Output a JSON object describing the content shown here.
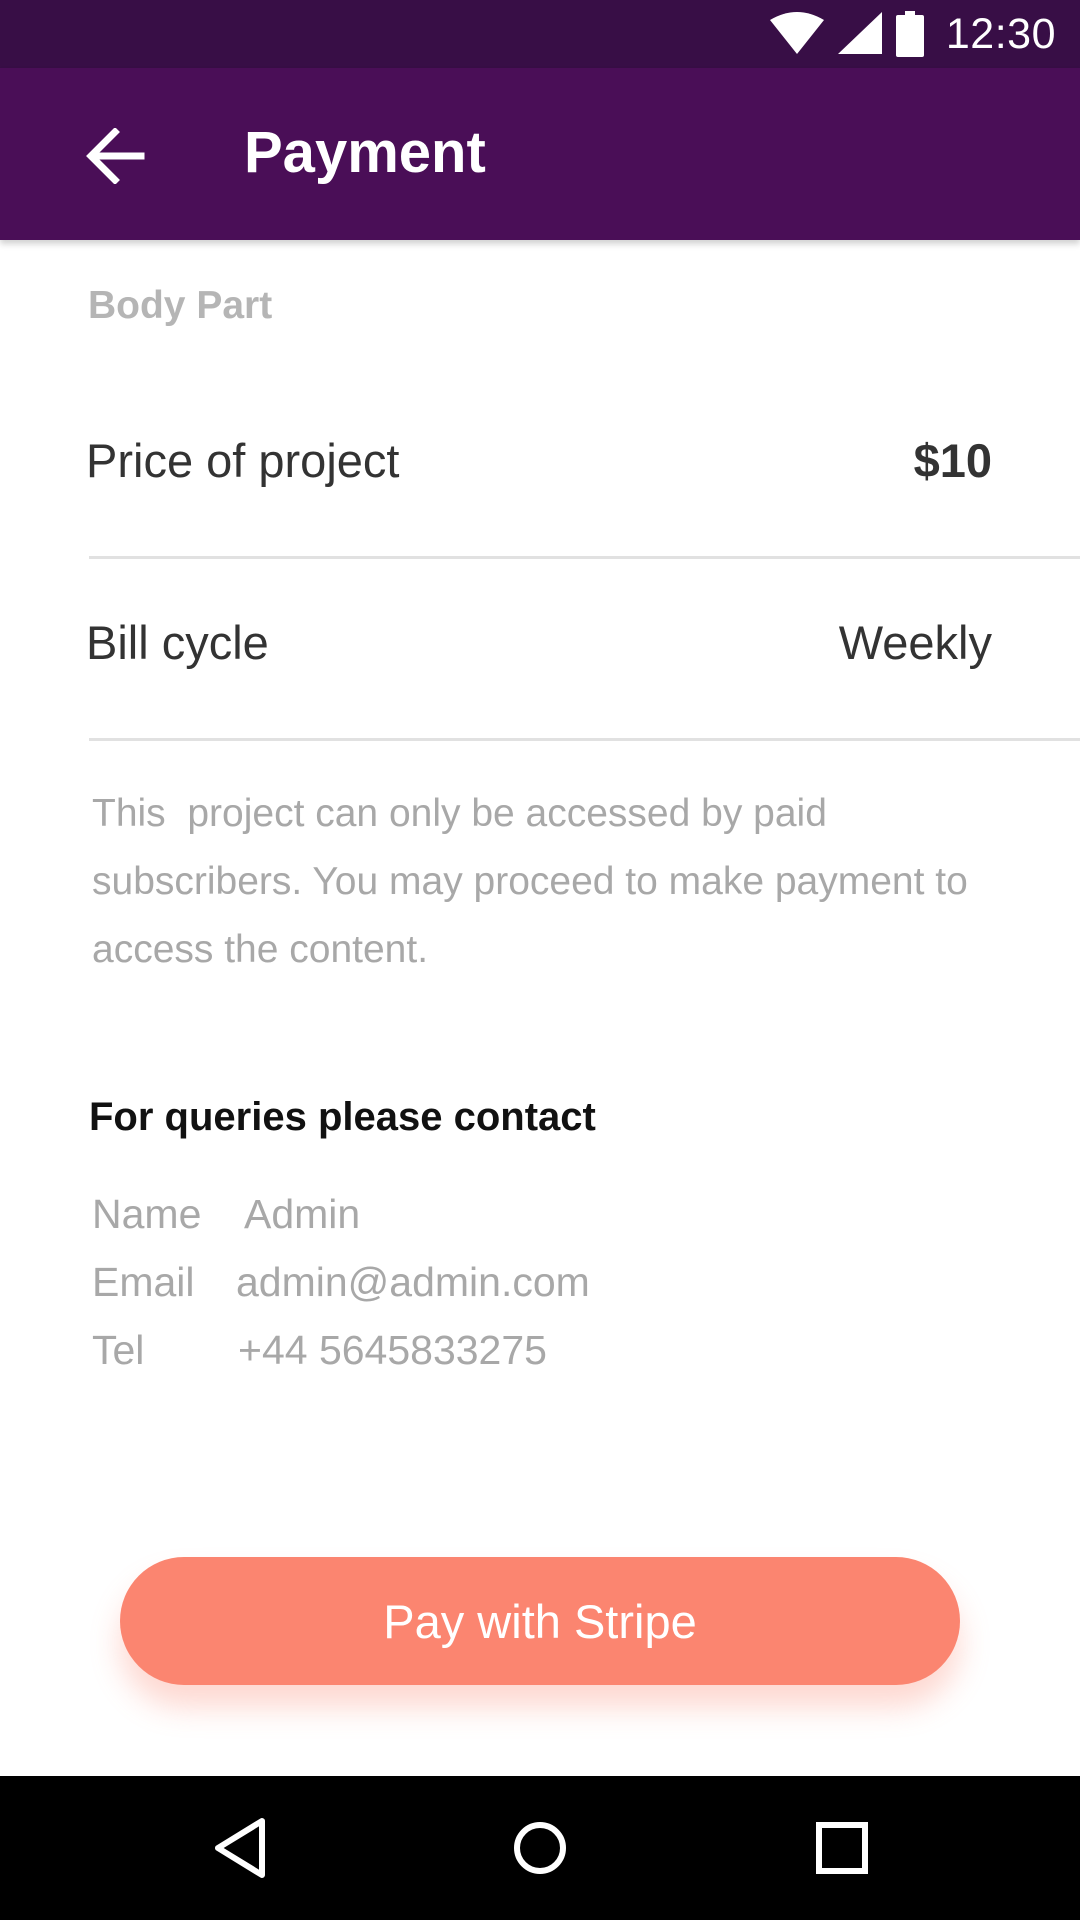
{
  "status_bar": {
    "time": "12:30",
    "icons": [
      "wifi-icon",
      "cellular-signal-icon",
      "battery-icon"
    ],
    "background": "#380e46"
  },
  "app_bar": {
    "title": "Payment",
    "back_icon": "arrow-left-icon",
    "background": "#4a0e57"
  },
  "content": {
    "section_label": "Body Part",
    "rows": [
      {
        "label": "Price of project",
        "value": "$10"
      },
      {
        "label": "Bill cycle",
        "value": "Weekly"
      }
    ],
    "notice": "This  project can only be accessed by paid subscribers. You may proceed to make payment to access the content.",
    "contact": {
      "heading": "For queries please contact",
      "entries": [
        {
          "key": "Name",
          "value": "Admin"
        },
        {
          "key": "Email",
          "value": "admin@admin.com"
        },
        {
          "key": "Tel",
          "value": "+44 5645833275"
        }
      ]
    }
  },
  "pay_button": {
    "label": "Pay with Stripe",
    "color": "#fb8570"
  },
  "nav_bar": {
    "icons": [
      "back-triangle-icon",
      "home-circle-icon",
      "recents-square-icon"
    ]
  }
}
